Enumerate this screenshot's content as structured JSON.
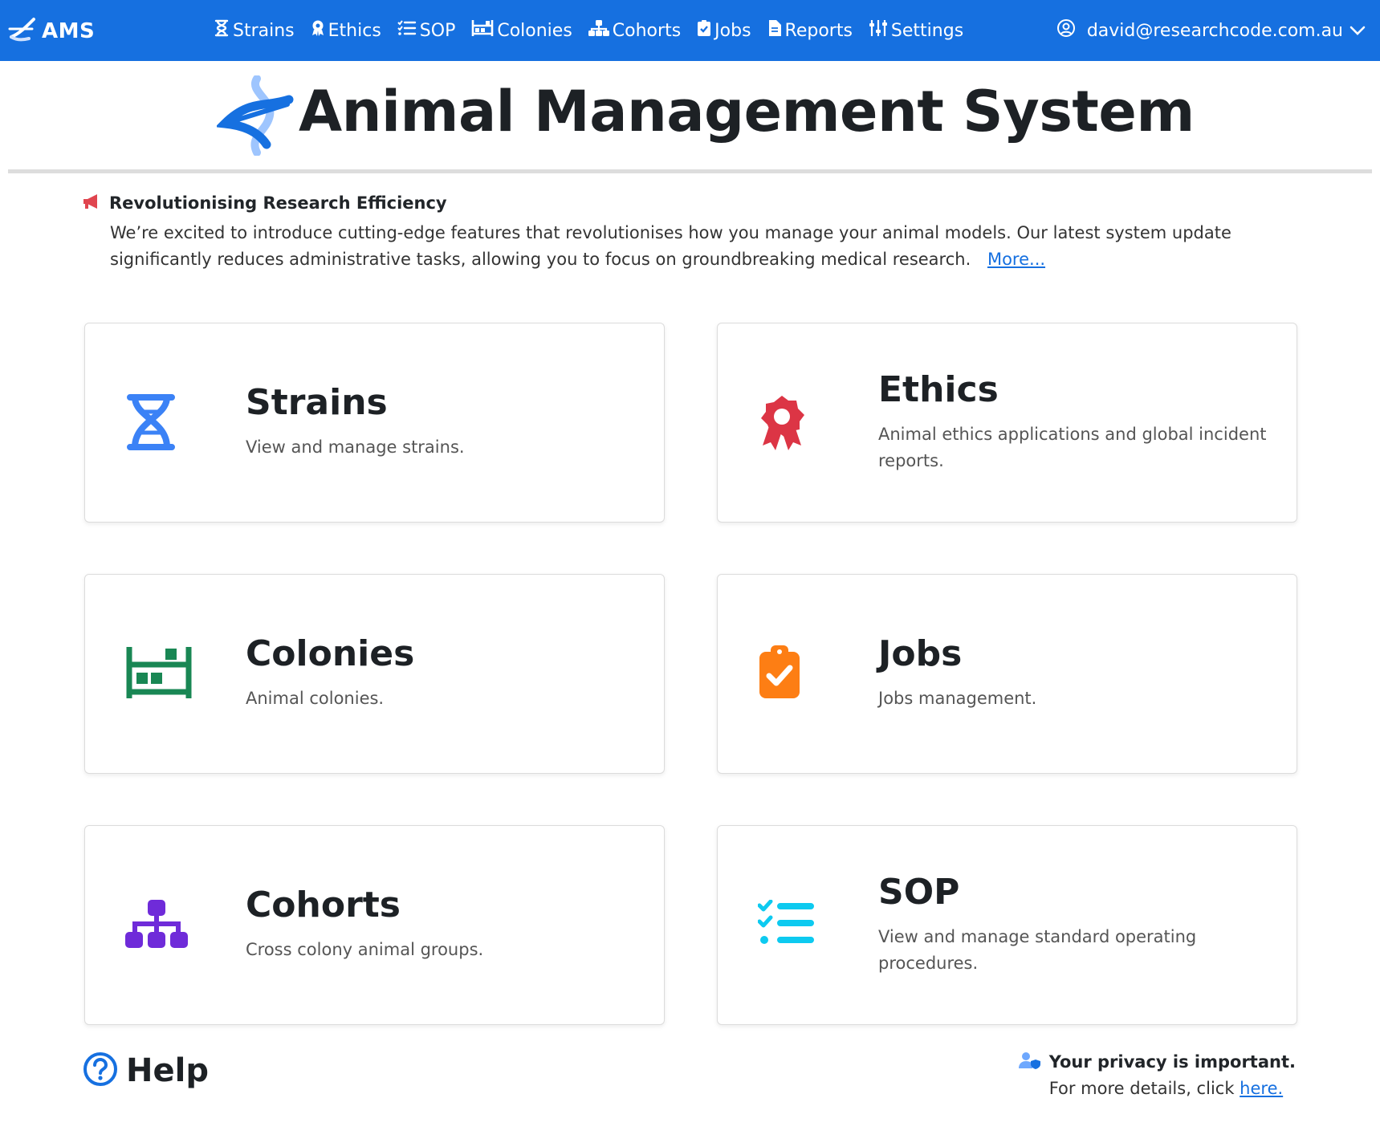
{
  "navbar": {
    "brand": "AMS",
    "items": [
      {
        "label": "Strains",
        "icon": "hourglass-icon"
      },
      {
        "label": "Ethics",
        "icon": "award-icon"
      },
      {
        "label": "SOP",
        "icon": "checklist-icon"
      },
      {
        "label": "Colonies",
        "icon": "rack-icon"
      },
      {
        "label": "Cohorts",
        "icon": "sitemap-icon"
      },
      {
        "label": "Jobs",
        "icon": "clipboard-check-icon"
      },
      {
        "label": "Reports",
        "icon": "file-icon"
      },
      {
        "label": "Settings",
        "icon": "sliders-icon"
      }
    ],
    "user_email": "david@researchcode.com.au"
  },
  "header": {
    "title": "Animal Management System"
  },
  "announcement": {
    "title": "Revolutionising Research Efficiency",
    "body": "We’re excited to introduce cutting-edge features that revolutionises how you manage your animal models. Our latest system update significantly reduces administrative tasks, allowing you to focus on groundbreaking medical research.",
    "more_link": "More..."
  },
  "cards": {
    "strains": {
      "title": "Strains",
      "description": "View and manage strains.",
      "icon": "dna-icon",
      "color": "#3b82f6"
    },
    "ethics": {
      "title": "Ethics",
      "description": "Animal ethics applications and global incident reports.",
      "icon": "award-ribbon-icon",
      "color": "#dc3545"
    },
    "colonies": {
      "title": "Colonies",
      "description": "Animal colonies.",
      "icon": "rack-icon",
      "color": "#198754"
    },
    "jobs": {
      "title": "Jobs",
      "description": "Jobs management.",
      "icon": "clipboard-check-icon",
      "color": "#fd7e14"
    },
    "cohorts": {
      "title": "Cohorts",
      "description": "Cross colony animal groups.",
      "icon": "sitemap-icon",
      "color": "#6f2bd9"
    },
    "sop": {
      "title": "SOP",
      "description": "View and manage standard operating procedures.",
      "icon": "checklist-icon",
      "color": "#0dcaf0"
    }
  },
  "footer": {
    "help_label": "Help",
    "privacy_title": "Your privacy is important.",
    "privacy_text": "For more details, click",
    "privacy_link": "here."
  },
  "colors": {
    "navbar": "#1670e0",
    "link": "#1670e0",
    "megaphone": "#e0454f"
  }
}
